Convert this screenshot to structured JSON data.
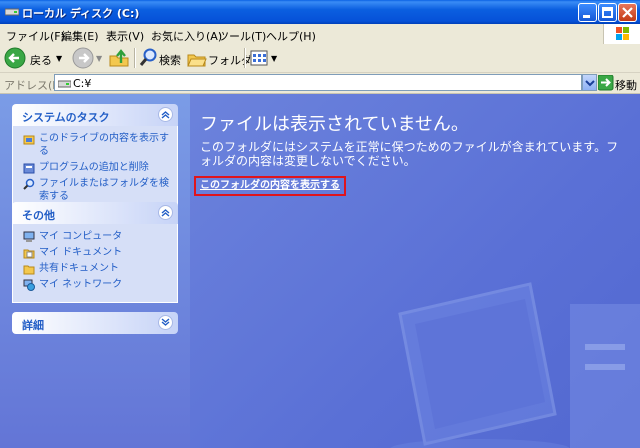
{
  "window": {
    "title": "ローカル ディスク (C:)",
    "buttons": {
      "minimize": "minimize-icon",
      "maximize": "maximize-icon",
      "close": "close-icon"
    }
  },
  "menu": [
    "ファイル(F)",
    "編集(E)",
    "表示(V)",
    "お気に入り(A)",
    "ツール(T)",
    "ヘルプ(H)"
  ],
  "toolbar": {
    "back": "戻る",
    "search": "検索",
    "folders": "フォルダ"
  },
  "address": {
    "label": "アドレス(D)",
    "value": "C:¥",
    "go": "移動"
  },
  "tasks": {
    "system": {
      "title": "システムのタスク",
      "items": [
        "このドライブの内容を表示する",
        "プログラムの追加と削除",
        "ファイルまたはフォルダを検索する"
      ]
    },
    "other": {
      "title": "その他",
      "items": [
        "マイ コンピュータ",
        "マイ ドキュメント",
        "共有ドキュメント",
        "マイ ネットワーク"
      ]
    },
    "details": {
      "title": "詳細"
    }
  },
  "content": {
    "headline": "ファイルは表示されていません。",
    "description": "このフォルダにはシステムを正常に保つためのファイルが含まれています。フォルダの内容は変更しないでください。",
    "show_link": "このフォルダの内容を表示する"
  },
  "colors": {
    "accent_blue": "#215dc6",
    "content_bg": "#5a74d8",
    "highlight_border": "#e0141c"
  }
}
